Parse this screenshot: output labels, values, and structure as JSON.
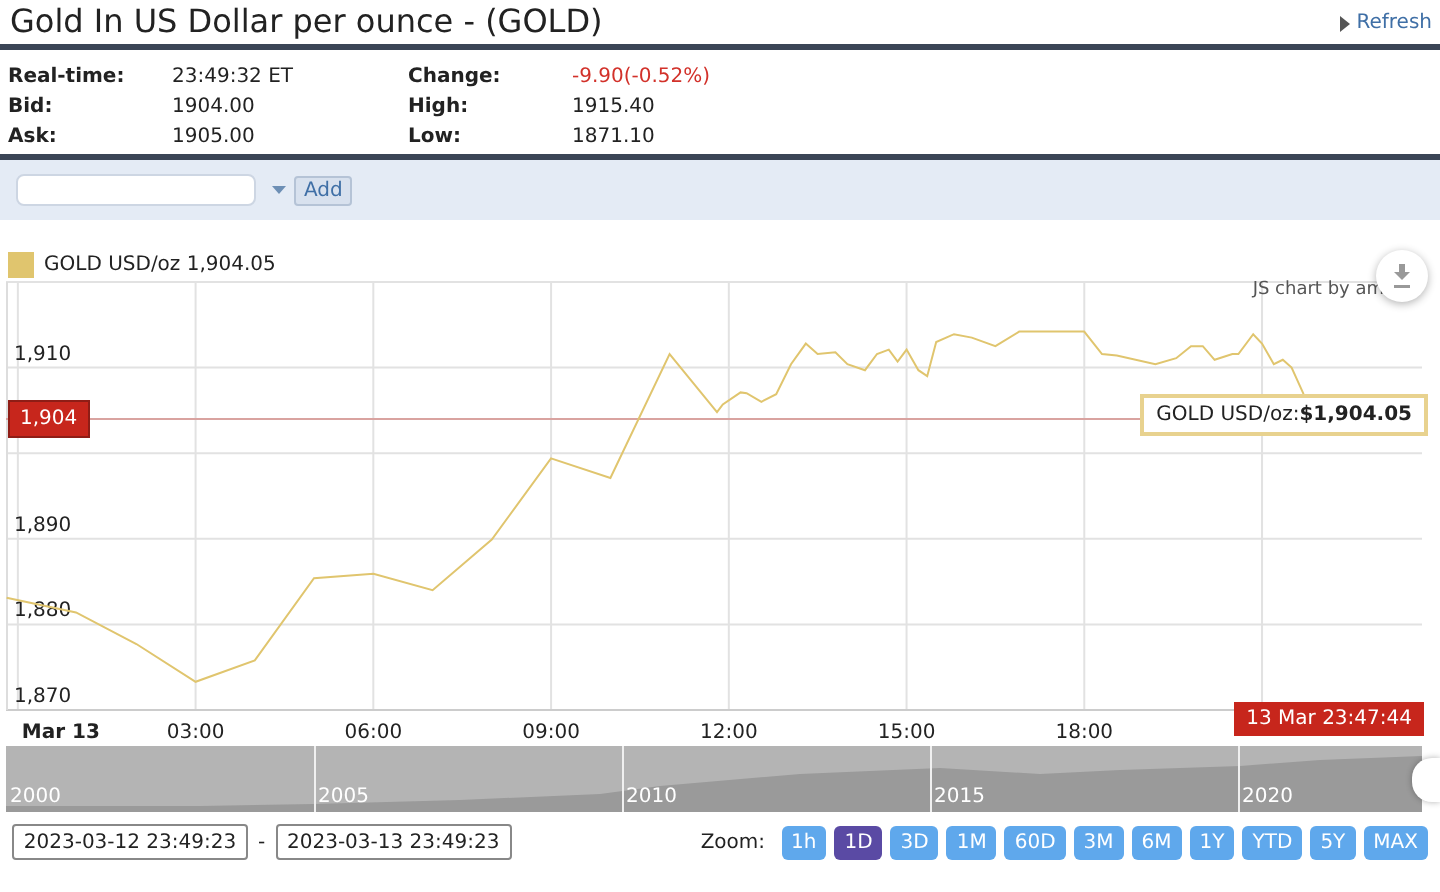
{
  "header": {
    "title": "Gold In US Dollar per ounce - (GOLD)",
    "refresh_link": "Refresh"
  },
  "quote": [
    {
      "label": "Real-time:",
      "value": "23:49:32 ET",
      "label2": "Change:",
      "value2": "-9.90(-0.52%)",
      "negative": true
    },
    {
      "label": "Bid:",
      "value": "1904.00",
      "label2": "High:",
      "value2": "1915.40",
      "negative": false
    },
    {
      "label": "Ask:",
      "value": "1905.00",
      "label2": "Low:",
      "value2": "1871.10",
      "negative": false
    }
  ],
  "compare": {
    "button": "Add"
  },
  "chart": {
    "legend_value": "1,904.05",
    "credit": "JS chart by am",
    "cursor_label": "13 Mar 23:47:44",
    "tooltip": "GOLD USD/oz:**$1,904.05**",
    "chart_data": {
      "type": "line",
      "xlim": [
        -0.2,
        23.7
      ],
      "ylim": [
        1870,
        1920
      ],
      "grid": true,
      "ref_lines": [
        {
          "axis": "y",
          "value": 1904,
          "label": "1,904",
          "color": "#d9a3a0"
        }
      ],
      "xticks": [
        {
          "value": 0,
          "label": "Mar 13"
        },
        {
          "value": 3,
          "label": "03:00"
        },
        {
          "value": 6,
          "label": "06:00"
        },
        {
          "value": 9,
          "label": "09:00"
        },
        {
          "value": 12,
          "label": "12:00"
        },
        {
          "value": 15,
          "label": "15:00"
        },
        {
          "value": 18,
          "label": "18:00"
        }
      ],
      "yticks": [
        {
          "value": 1870,
          "label": "1,870"
        },
        {
          "value": 1880,
          "label": "1,880"
        },
        {
          "value": 1890,
          "label": "1,890"
        },
        {
          "value": 1910,
          "label": "1,910"
        }
      ],
      "x": [
        -0.19,
        0.98,
        2,
        3,
        4,
        5,
        6,
        7,
        8,
        9,
        10,
        11,
        11.8,
        11.9,
        12.2,
        12.3,
        12.55,
        12.8,
        13.05,
        13.3,
        13.5,
        13.8,
        14,
        14.3,
        14.5,
        14.7,
        14.85,
        15,
        15.2,
        15.35,
        15.5,
        15.8,
        16.1,
        16.5,
        16.9,
        18,
        18.3,
        18.55,
        19.2,
        19.55,
        19.8,
        20,
        20.2,
        20.5,
        20.6,
        20.85,
        21,
        21.2,
        21.35,
        21.5,
        21.7
      ],
      "series": [
        {
          "name": "GOLD USD/oz",
          "color": "#e0c56e",
          "values": [
            1883.1,
            1881.4,
            1877.7,
            1873.3,
            1875.8,
            1885.4,
            1885.9,
            1884,
            1889.9,
            1899.4,
            1897.1,
            1911.6,
            1904.8,
            1905.7,
            1907.1,
            1907,
            1906,
            1906.9,
            1910.4,
            1912.8,
            1911.6,
            1911.8,
            1910.4,
            1909.7,
            1911.6,
            1912.1,
            1910.7,
            1912.1,
            1909.7,
            1909,
            1913,
            1913.9,
            1913.5,
            1912.5,
            1914.2,
            1914.2,
            1911.6,
            1911.4,
            1910.4,
            1911.1,
            1912.5,
            1912.5,
            1910.9,
            1911.6,
            1911.6,
            1913.9,
            1912.8,
            1910.4,
            1910.9,
            1910,
            1906.9
          ]
        }
      ]
    }
  },
  "navigator": {
    "years": [
      "2000",
      "2005",
      "2010",
      "2015",
      "2020"
    ]
  },
  "range": {
    "from": "2023-03-12 23:49:23",
    "separator": "-",
    "to": "2023-03-13 23:49:23"
  },
  "zoom": {
    "label": "Zoom:",
    "buttons": [
      {
        "label": "1h",
        "selected": false
      },
      {
        "label": "1D",
        "selected": true
      },
      {
        "label": "3D",
        "selected": false
      },
      {
        "label": "1M",
        "selected": false
      },
      {
        "label": "60D",
        "selected": false
      },
      {
        "label": "3M",
        "selected": false
      },
      {
        "label": "6M",
        "selected": false
      },
      {
        "label": "1Y",
        "selected": false
      },
      {
        "label": "YTD",
        "selected": false
      },
      {
        "label": "5Y",
        "selected": false
      },
      {
        "label": "MAX",
        "selected": false
      }
    ]
  }
}
